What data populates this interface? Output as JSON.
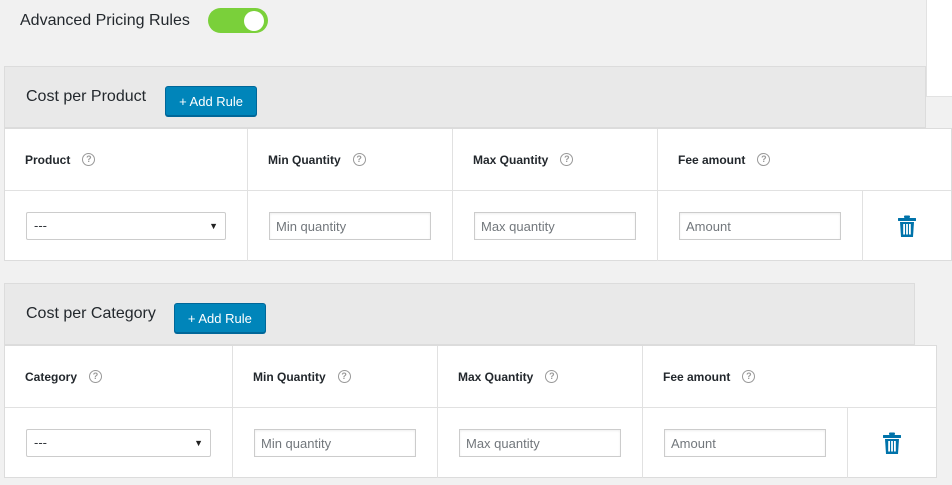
{
  "toggle": {
    "label": "Advanced Pricing Rules",
    "state": "on",
    "color": "#7ad03a"
  },
  "sections": [
    {
      "title": "Cost per Product",
      "add_button": "+ Add Rule",
      "headers": [
        "Product",
        "Min Quantity",
        "Max Quantity",
        "Fee amount"
      ],
      "help_glyph": "?",
      "row": {
        "select_value": "---",
        "min_placeholder": "Min quantity",
        "max_placeholder": "Max quantity",
        "fee_placeholder": "Amount"
      }
    },
    {
      "title": "Cost per Category",
      "add_button": "+ Add Rule",
      "headers": [
        "Category",
        "Min Quantity",
        "Max Quantity",
        "Fee amount"
      ],
      "help_glyph": "?",
      "row": {
        "select_value": "---",
        "min_placeholder": "Min quantity",
        "max_placeholder": "Max quantity",
        "fee_placeholder": "Amount"
      }
    }
  ],
  "colors": {
    "accent": "#0085ba",
    "trash": "#0073aa"
  },
  "icons": {
    "help": "help-circle-icon",
    "delete": "trash-icon",
    "dropdown": "triangle-down-icon"
  }
}
